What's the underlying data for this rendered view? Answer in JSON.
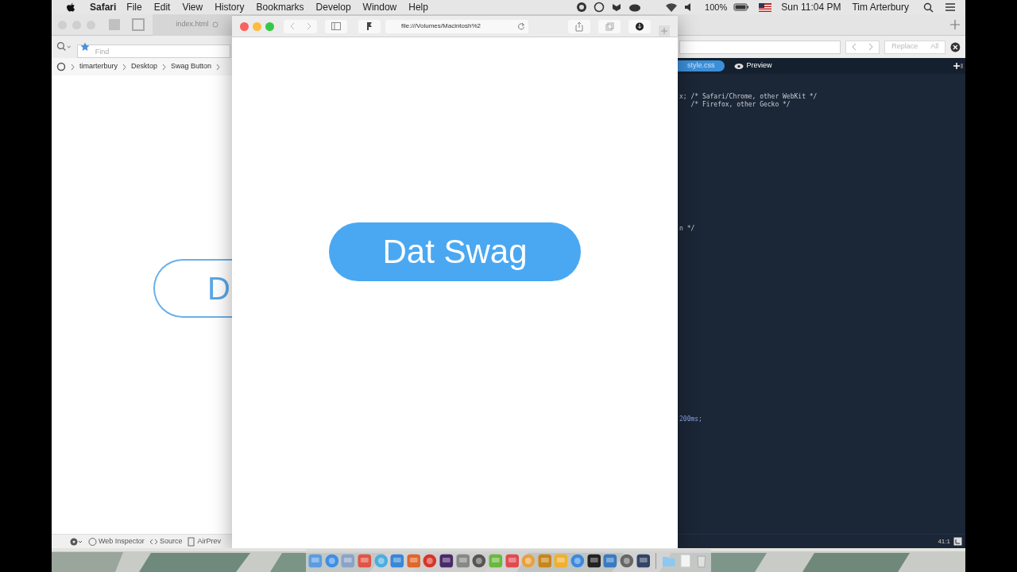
{
  "menu_bar": {
    "app": "Safari",
    "menus": [
      "File",
      "Edit",
      "View",
      "History",
      "Bookmarks",
      "Develop",
      "Window",
      "Help"
    ],
    "battery": "100%",
    "clock": "Sun 11:04 PM",
    "user": "Tim Arterbury"
  },
  "editor": {
    "tab": "index.html",
    "find_placeholder": "Find",
    "replace_button": "Replace",
    "all_button": "All",
    "breadcrumbs": [
      "timarterbury",
      "Desktop",
      "Swag Button"
    ],
    "preview_button_text": "D",
    "file_tabs": [
      {
        "label": "style.css",
        "selected": true
      },
      {
        "label": "Preview",
        "selected": false
      }
    ],
    "code_lines": [
      {
        "text": "x; /* Safari/Chrome, other WebKit */"
      },
      {
        "text": "   /* Firefox, other Gecko */"
      },
      {
        "text": "n */"
      },
      {
        "text": "200ms;"
      }
    ],
    "cursor_position": "41:1",
    "bottom_bar": [
      "Web Inspector",
      "Source",
      "AirPrev"
    ]
  },
  "safari": {
    "url": "file:///Volumes/Macintosh%2",
    "button_label": "Dat Swag"
  }
}
